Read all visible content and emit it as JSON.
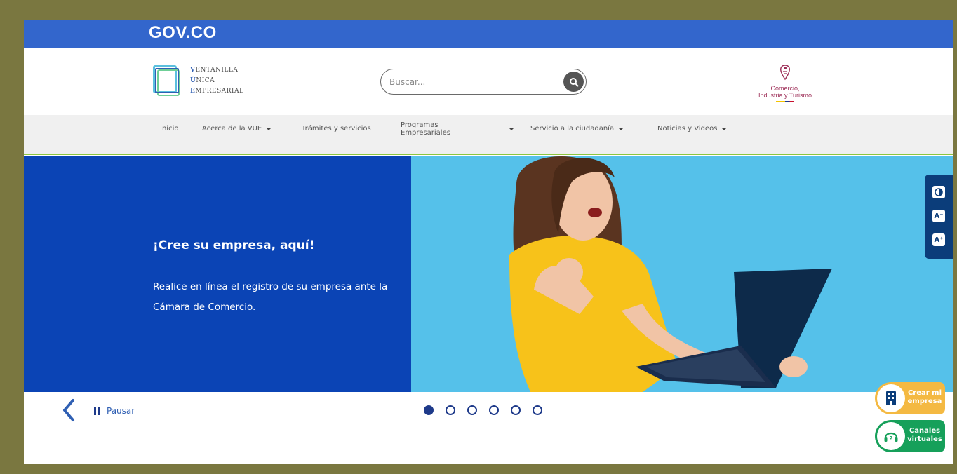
{
  "gov_bar": {
    "logo_text": "GOV.CO"
  },
  "header": {
    "vue_logo": {
      "line1": "ENTANILLA",
      "line1_cap": "V",
      "line2": "NICA",
      "line2_cap": "Ú",
      "line3": "MPRESARIAL",
      "line3_cap": "E"
    },
    "search": {
      "placeholder": "Buscar..."
    },
    "ministry": {
      "line1": "Comercio,",
      "line2": "Industria y Turismo"
    }
  },
  "nav": {
    "items": [
      {
        "label": "Inicio",
        "has_dropdown": false
      },
      {
        "label": "Acerca de la VUE",
        "has_dropdown": true
      },
      {
        "label": "Trámites y servicios",
        "has_dropdown": false
      },
      {
        "label": "Programas Empresariales",
        "has_dropdown": true
      },
      {
        "label": "Servicio a la ciudadanía",
        "has_dropdown": true
      },
      {
        "label": "Noticias y Videos",
        "has_dropdown": true
      }
    ]
  },
  "hero": {
    "title": "¡Cree su empresa, aquí!",
    "description": "Realice en línea el registro de su empresa ante la Cámara de Comercio."
  },
  "carousel": {
    "pause_label": "Pausar",
    "slide_count": 6,
    "active_index": 0
  },
  "floating": {
    "create_company": "Crear mi empresa",
    "virtual_channels": "Canales virtuales"
  },
  "colors": {
    "gov_blue": "#3366cc",
    "hero_blue": "#0b44b5",
    "sky_blue": "#55c1ea",
    "accent_green": "#8dc63f",
    "fab_orange": "#f4b942",
    "fab_green": "#16a05a"
  }
}
